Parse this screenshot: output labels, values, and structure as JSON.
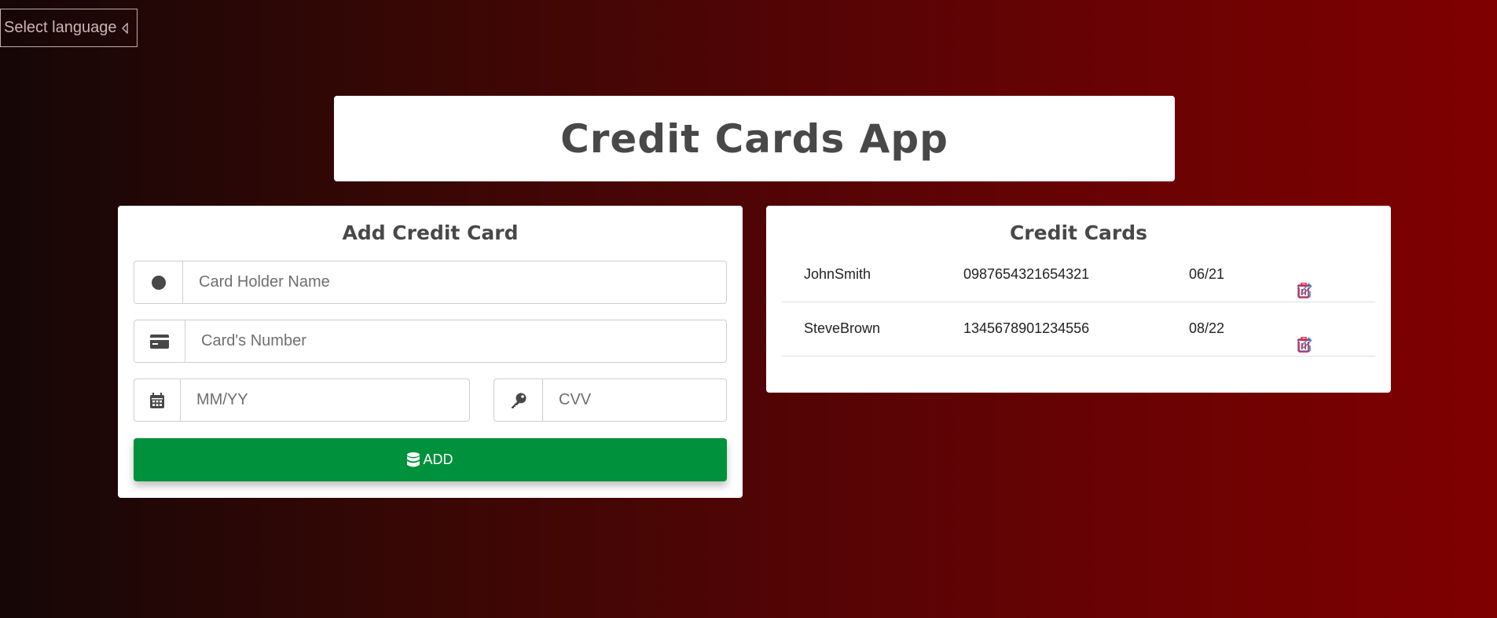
{
  "language_selector": {
    "label": "Select language",
    "icon": "caret-left-icon"
  },
  "header": {
    "title": "Credit Cards App"
  },
  "add_form": {
    "title": "Add Credit Card",
    "holder_name": {
      "placeholder": "Card Holder Name",
      "value": "",
      "icon": "circle-icon"
    },
    "card_number": {
      "placeholder": "Card's Number",
      "value": "",
      "icon": "credit-card-icon"
    },
    "expiry": {
      "placeholder": "MM/YY",
      "value": "",
      "icon": "calendar-icon"
    },
    "cvv": {
      "placeholder": "CVV",
      "value": "",
      "icon": "key-icon"
    },
    "add_button": {
      "label": "ADD",
      "icon": "database-icon"
    }
  },
  "cards_list": {
    "title": "Credit Cards",
    "cards": [
      {
        "name": "JohnSmith",
        "number": "0987654321654321",
        "expiry": "06/21"
      },
      {
        "name": "SteveBrown",
        "number": "1345678901234556",
        "expiry": "08/22"
      }
    ]
  },
  "colors": {
    "accent_green": "#00913c",
    "edit_blue": "#2aa3d8",
    "delete_red": "#e0254a",
    "heading_gray": "#484848"
  }
}
